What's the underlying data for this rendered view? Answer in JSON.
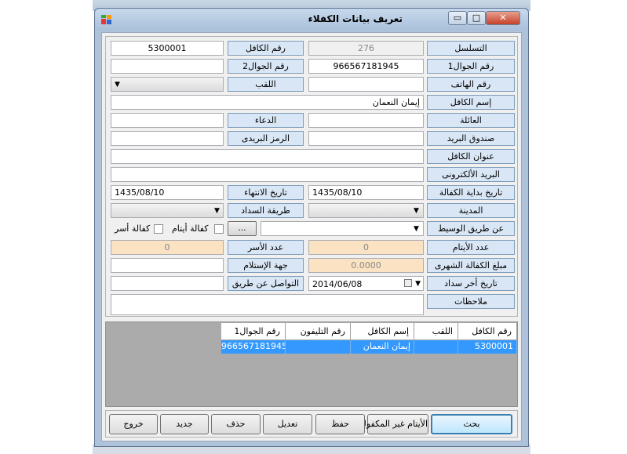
{
  "window": {
    "title": "تعريف بيانات الكفلاء",
    "min": "▭",
    "max": "□",
    "close": "✕"
  },
  "labels": {
    "serial": "التسلسل",
    "sponsor_no": "رقم الكافل",
    "mobile1": "رقم الجوال1",
    "mobile2": "رقم الجوال2",
    "phone": "رقم الهاتف",
    "title_lbl": "اللقب",
    "sponsor_name": "إسم الكافل",
    "family": "العائلة",
    "prayer": "الدعاء",
    "po_box": "صندوق البريد",
    "zip": "الرمز البريدى",
    "address": "عنوان الكافل",
    "email": "البريد الألكترونى",
    "start_date": "تاريخ بداية الكفالة",
    "end_date": "تاريخ الانتهاء",
    "city": "المدينة",
    "payment_method": "طريقة السداد",
    "via": "عن طريق الوسيط",
    "orphans_count": "عدد الأيتام",
    "families_count": "عدد الأسر",
    "monthly_amount": "مبلغ الكفالة الشهرى",
    "receiver": "جهة الإستلام",
    "last_payment": "تاريخ أخر سداد",
    "contact_via": "التواصل عن طريق",
    "notes": "ملاحظات",
    "orphans_sponsor": "كفالة أيتام",
    "families_sponsor": "كفالة أسر"
  },
  "values": {
    "serial": "276",
    "sponsor_no": "5300001",
    "mobile1": "966567181945",
    "mobile2": "",
    "phone": "",
    "sponsor_name": "إيمان النعمان",
    "family": "",
    "prayer": "",
    "po_box": "",
    "zip": "",
    "address": "",
    "email": "",
    "start_date": "1435/08/10",
    "end_date": "1435/08/10",
    "orphans_count": "0",
    "families_count": "0",
    "monthly_amount": "0.0000",
    "receiver": "",
    "last_payment": "2014/06/08",
    "contact_via": "",
    "notes": "",
    "dots": "..."
  },
  "grid": {
    "headers": [
      "رقم الكافل",
      "اللقب",
      "إسم الكافل",
      "رقم التليفون",
      "رقم الجوال1"
    ],
    "rows": [
      [
        "5300001",
        "",
        "إيمان النعمان",
        "",
        "966567181945"
      ]
    ]
  },
  "buttons": {
    "search": "بحث",
    "unsponsored": "الأيتام غير المكفولين",
    "save": "حفظ",
    "edit": "تعديل",
    "delete": "حذف",
    "new": "جديد",
    "exit": "خروج"
  },
  "colors": {
    "selection": "#3399ff",
    "label_bg": "#d9e6f5",
    "disabled_tan": "#fbe2c2"
  },
  "icons": {
    "dropdown": "chevron-down-icon",
    "calendar": "calendar-icon"
  }
}
